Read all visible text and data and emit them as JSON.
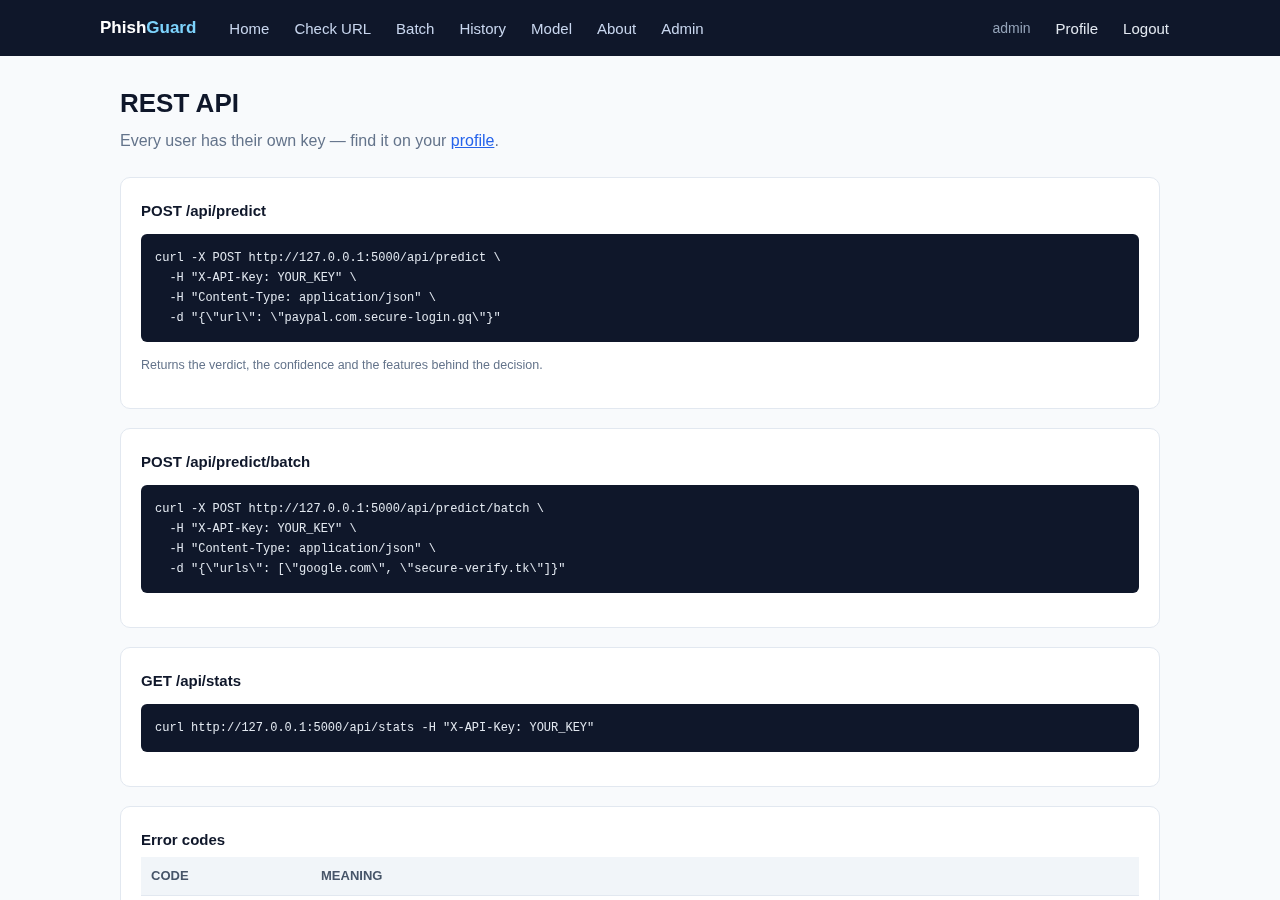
{
  "navbar": {
    "brand": {
      "name": "Phish",
      "accent": "Guard"
    },
    "links": [
      "Home",
      "Check URL",
      "Batch",
      "History",
      "Model",
      "About",
      "Admin"
    ],
    "user": "admin",
    "account_links": [
      "Profile",
      "Logout"
    ]
  },
  "header": {
    "title": "REST API",
    "subtitle": "Every user has their own key — find it on your ",
    "subtitle_link": "profile",
    "subtitle_end": "."
  },
  "sections": [
    {
      "kind": "endpoint",
      "title": "POST /api/predict",
      "code_lines": [
        "curl -X POST http://127.0.0.1:5000/api/predict \\",
        "  -H \"X-API-Key: YOUR_KEY\" \\",
        "  -H \"Content-Type: application/json\" \\",
        "  -d \"{\\\"url\\\": \\\"paypal.com.secure-login.gq\\\"}\""
      ],
      "note": "Returns the verdict, the confidence and the features behind the decision."
    },
    {
      "kind": "endpoint",
      "title": "POST /api/predict/batch",
      "code_lines": [
        "curl -X POST http://127.0.0.1:5000/api/predict/batch \\",
        "  -H \"X-API-Key: YOUR_KEY\" \\",
        "  -H \"Content-Type: application/json\" \\",
        "  -d \"{\\\"urls\\\": [\\\"google.com\\\", \\\"secure-verify.tk\\\"]}\""
      ]
    },
    {
      "kind": "endpoint",
      "title": "GET /api/stats",
      "code_lines": [
        "curl http://127.0.0.1:5000/api/stats -H \"X-API-Key: YOUR_KEY\""
      ]
    },
    {
      "kind": "table",
      "title": "Error codes",
      "columns": [
        "CODE",
        "MEANING"
      ]
    }
  ]
}
